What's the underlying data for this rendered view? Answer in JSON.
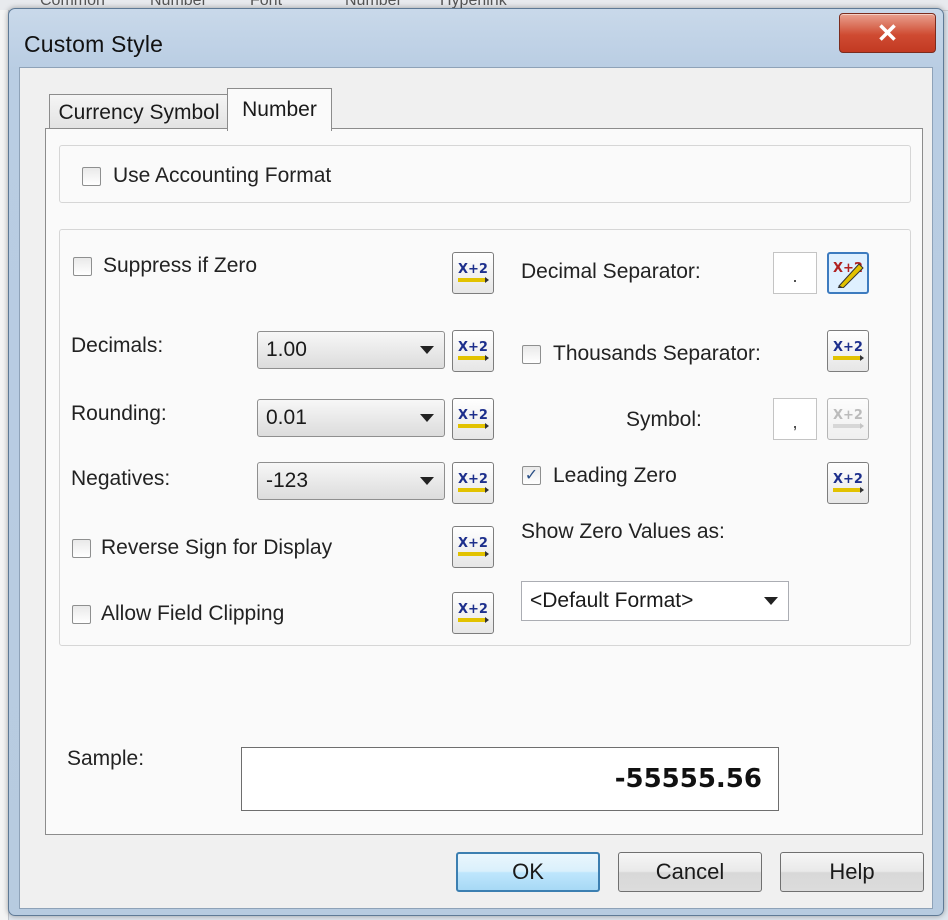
{
  "background": {
    "tabs": [
      "Common",
      "Number",
      "Font",
      "Number",
      "Hyperlink"
    ]
  },
  "window": {
    "title": "Custom Style",
    "close_label": "✕"
  },
  "tabs": [
    {
      "label": "Currency Symbol",
      "active": false
    },
    {
      "label": "Number",
      "active": true
    }
  ],
  "accounting": {
    "label": "Use Accounting Format",
    "checked": false
  },
  "left": {
    "suppress_zero": {
      "label": "Suppress if Zero",
      "checked": false
    },
    "decimals": {
      "label": "Decimals:",
      "value": "1.00"
    },
    "rounding": {
      "label": "Rounding:",
      "value": "0.01"
    },
    "negatives": {
      "label": "Negatives:",
      "value": "-123"
    },
    "reverse_sign": {
      "label": "Reverse Sign for Display",
      "checked": false
    },
    "allow_clipping": {
      "label": "Allow Field Clipping",
      "checked": false
    }
  },
  "right": {
    "decimal_separator": {
      "label": "Decimal Separator:",
      "value": "."
    },
    "thousands_separator": {
      "label": "Thousands Separator:",
      "checked": false
    },
    "symbol": {
      "label": "Symbol:",
      "value": ","
    },
    "leading_zero": {
      "label": "Leading Zero",
      "checked": true,
      "check_glyph": "✓"
    },
    "show_zero": {
      "label": "Show Zero Values as:",
      "value": "<Default Format>"
    }
  },
  "sample": {
    "label": "Sample:",
    "value": "-55555.56"
  },
  "buttons": {
    "ok": "OK",
    "cancel": "Cancel",
    "help": "Help"
  },
  "formula_icon_text": "X+2",
  "colors": {
    "accent": "#3c7fb1",
    "close": "#c94a33"
  }
}
